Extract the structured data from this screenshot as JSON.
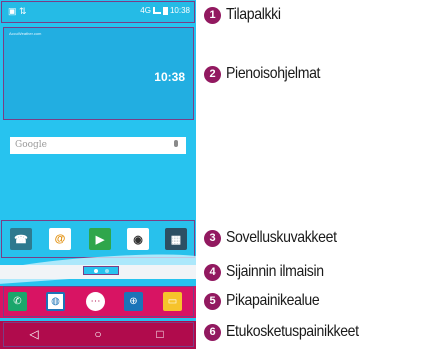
{
  "status_bar": {
    "time": "10:38",
    "network": "4G"
  },
  "widget": {
    "time": "10:38",
    "small_text": "AccuWeather.com"
  },
  "google_bar": {
    "text": "Google"
  },
  "app_icons": [
    "contacts-app",
    "email-app",
    "play-store-app",
    "camera-app",
    "apps-folder"
  ],
  "dock_icons": [
    "phone-app",
    "contacts-app",
    "apps-drawer",
    "browser-app",
    "messaging-app"
  ],
  "nav": {
    "back": "◁",
    "home": "○",
    "recents": "□"
  },
  "callouts": [
    {
      "number": "1",
      "label": "Tilapalkki"
    },
    {
      "number": "2",
      "label": "Pienoisohjelmat"
    },
    {
      "number": "3",
      "label": "Sovelluskuvakkeet"
    },
    {
      "number": "4",
      "label": "Sijainnin ilmaisin"
    },
    {
      "number": "5",
      "label": "Pikapainikealue"
    },
    {
      "number": "6",
      "label": "Etukosketuspainikkeet"
    }
  ],
  "colors": {
    "screen": "#27c3ef",
    "dock": "#d81463",
    "nav": "#b00b4c",
    "badge": "#921960",
    "frame": "#7a3e86"
  }
}
